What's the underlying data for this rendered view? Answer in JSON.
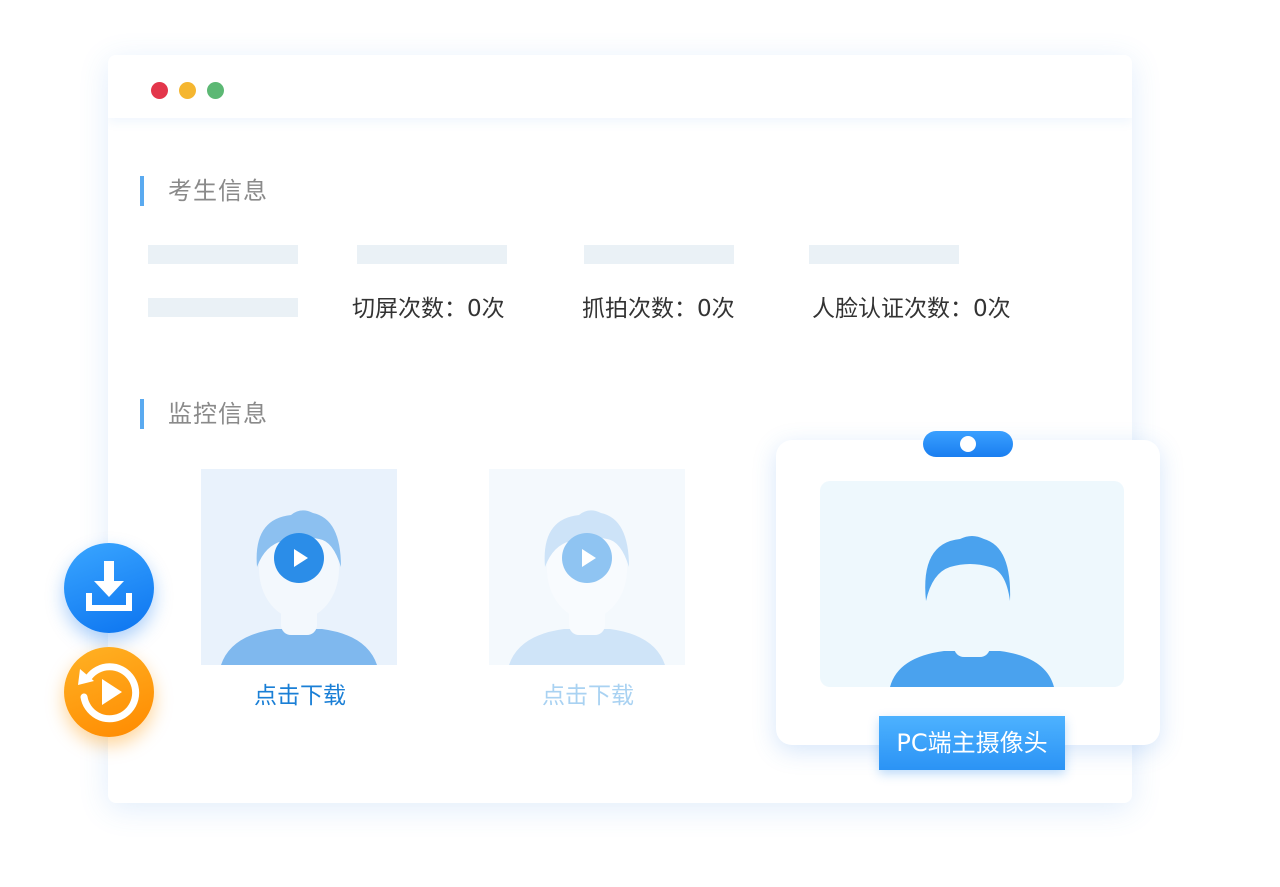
{
  "window": {
    "controls": {
      "close_color": "#e3364b",
      "minimize_color": "#f5b630",
      "maximize_color": "#5cb874"
    }
  },
  "student_info": {
    "title": "考生信息",
    "stats": [
      {
        "label": "切屏次数：0次"
      },
      {
        "label": "抓拍次数：0次"
      },
      {
        "label": "人脸认证次数：0次"
      }
    ]
  },
  "monitor_info": {
    "title": "监控信息",
    "videos": [
      {
        "link_label": "点击下载",
        "state": "active",
        "link_color": "#1a7fd6"
      },
      {
        "link_label": "点击下载",
        "state": "faded",
        "link_color": "#a9d2f2"
      }
    ]
  },
  "camera": {
    "label": "PC端主摄像头"
  },
  "floating_buttons": [
    {
      "icon": "download-icon"
    },
    {
      "icon": "replay-icon"
    }
  ],
  "colors": {
    "accent_blue": "#2b93f5",
    "accent_orange": "#ff9a0a",
    "section_bar": "#5aaaf0"
  }
}
